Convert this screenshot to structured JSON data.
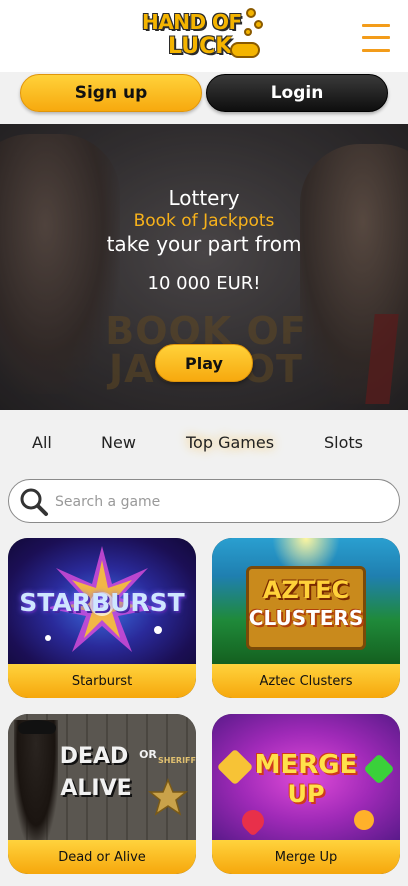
{
  "header": {
    "logo_line1": "HAND OF",
    "logo_line2": "LUCK",
    "menu_icon": "hamburger-menu-icon"
  },
  "auth": {
    "signup_label": "Sign up",
    "login_label": "Login"
  },
  "banner": {
    "line1": "Lottery",
    "line2": "Book of Jackpots",
    "line3": "take your part from",
    "line4": "10 000 EUR!",
    "background_title": "BOOK OF JACKPOT",
    "play_label": "Play"
  },
  "tabs": [
    {
      "label": "All"
    },
    {
      "label": "New"
    },
    {
      "label": "Top Games",
      "active": true
    },
    {
      "label": "Slots"
    }
  ],
  "search": {
    "placeholder": "Search a game",
    "icon": "search-icon"
  },
  "games": [
    {
      "name": "Starburst",
      "art_title": "STARBURST"
    },
    {
      "name": "Aztec Clusters",
      "art_title_1": "AZTEC",
      "art_title_2": "CLUSTERS"
    },
    {
      "name": "Dead or Alive",
      "art_title_1": "DEAD",
      "art_title_2": "OR",
      "art_title_3": "ALIVE",
      "art_badge": "SHERIFF"
    },
    {
      "name": "Merge Up",
      "art_title_1": "MERGE",
      "art_title_2": "UP"
    }
  ],
  "colors": {
    "accent": "#f7a90e",
    "accent_light": "#ffd23a",
    "login_bg": "#0e0e0e",
    "page_bg": "#f1f1f1",
    "banner_highlight": "#f7b21b"
  }
}
